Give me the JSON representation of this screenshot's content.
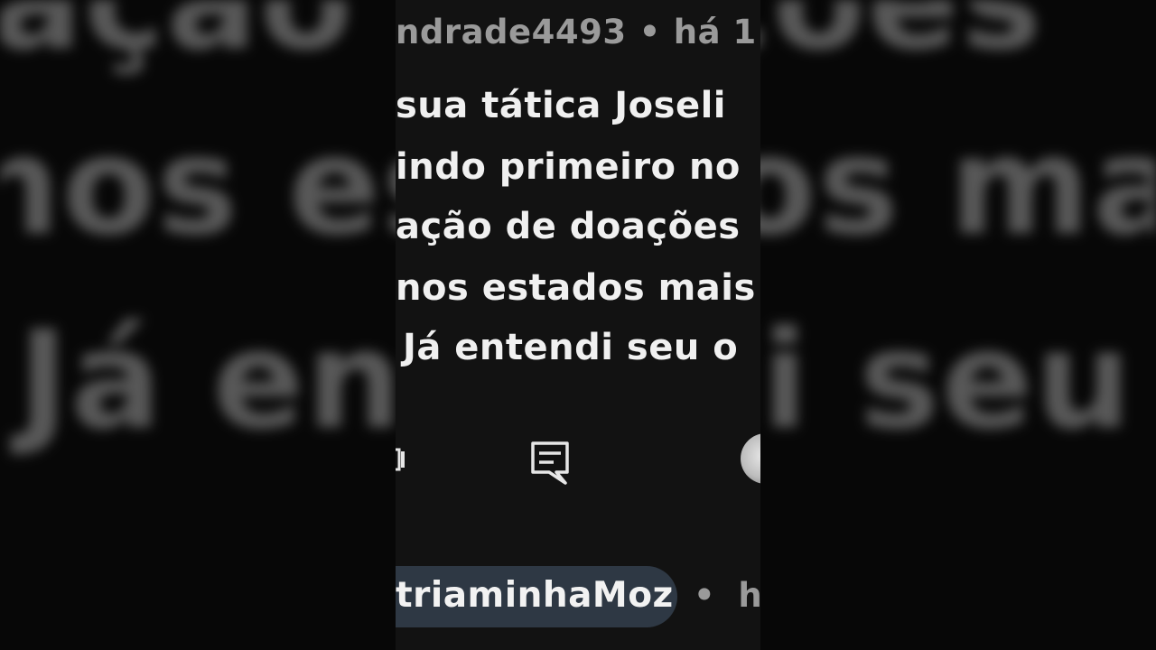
{
  "background": {
    "line1": "ação  doações",
    "line2": "nos  estados  mais",
    "line3": "Já  entendi  seu  o"
  },
  "comment": {
    "author": "ndrade4493",
    "separator": "•",
    "time": "há 1",
    "lines": [
      "sua tática Joseli",
      "indo primeiro no",
      "ação de doações",
      "nos estados mais",
      "Já entendi seu o"
    ]
  },
  "actions": {
    "left_icon": "like-icon",
    "reply_icon": "reply-comment-icon",
    "avatar": "avatar"
  },
  "next_comment": {
    "author": "triaminhaMoz",
    "separator": "•",
    "time": "há"
  },
  "colors": {
    "text_primary": "#f0f0f0",
    "text_secondary": "#9a9a9a",
    "chip_bg": "#2e3844",
    "strip_bg": "#121212"
  }
}
